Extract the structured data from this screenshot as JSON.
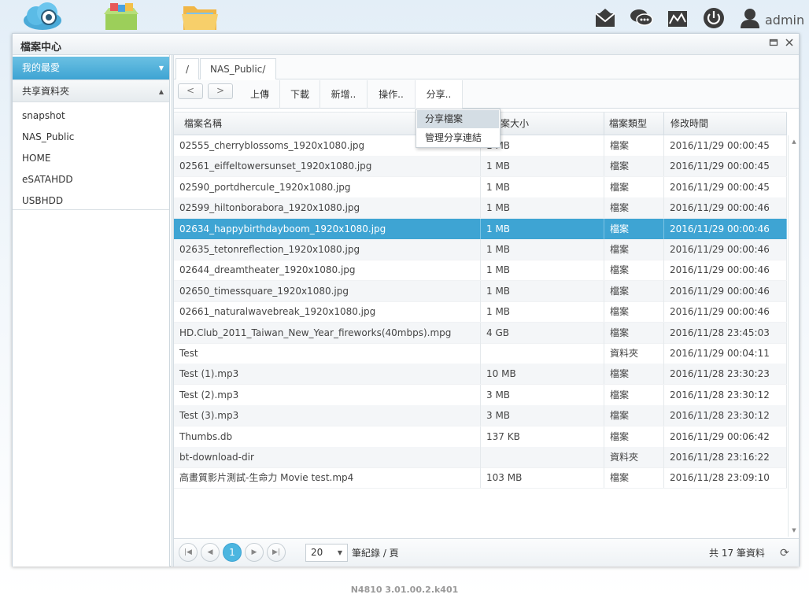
{
  "user": {
    "name": "admin"
  },
  "window": {
    "title": "檔案中心"
  },
  "sidebar": {
    "favorites_label": "我的最愛",
    "shared_label": "共享資料夾",
    "folders": [
      "snapshot",
      "NAS_Public",
      "HOME",
      "eSATAHDD",
      "USBHDD"
    ]
  },
  "breadcrumb": {
    "root": "/",
    "current": "NAS_Public/"
  },
  "toolbar": {
    "back": "<",
    "forward": ">",
    "upload": "上傳",
    "download": "下載",
    "new": "新增..",
    "action": "操作..",
    "share": "分享.."
  },
  "share_menu": {
    "items": [
      "分享檔案",
      "管理分享連結"
    ]
  },
  "grid": {
    "columns": [
      "檔案名稱",
      "檔案大小",
      "檔案類型",
      "修改時間"
    ],
    "rows": [
      {
        "name": "02555_cherryblossoms_1920x1080.jpg",
        "size": "1 MB",
        "type": "檔案",
        "modified": "2016/11/29 00:00:45"
      },
      {
        "name": "02561_eiffeltowersunset_1920x1080.jpg",
        "size": "1 MB",
        "type": "檔案",
        "modified": "2016/11/29 00:00:45"
      },
      {
        "name": "02590_portdhercule_1920x1080.jpg",
        "size": "1 MB",
        "type": "檔案",
        "modified": "2016/11/29 00:00:45"
      },
      {
        "name": "02599_hiltonborabora_1920x1080.jpg",
        "size": "1 MB",
        "type": "檔案",
        "modified": "2016/11/29 00:00:46"
      },
      {
        "name": "02634_happybirthdayboom_1920x1080.jpg",
        "size": "1 MB",
        "type": "檔案",
        "modified": "2016/11/29 00:00:46"
      },
      {
        "name": "02635_tetonreflection_1920x1080.jpg",
        "size": "1 MB",
        "type": "檔案",
        "modified": "2016/11/29 00:00:46"
      },
      {
        "name": "02644_dreamtheater_1920x1080.jpg",
        "size": "1 MB",
        "type": "檔案",
        "modified": "2016/11/29 00:00:46"
      },
      {
        "name": "02650_timessquare_1920x1080.jpg",
        "size": "1 MB",
        "type": "檔案",
        "modified": "2016/11/29 00:00:46"
      },
      {
        "name": "02661_naturalwavebreak_1920x1080.jpg",
        "size": "1 MB",
        "type": "檔案",
        "modified": "2016/11/29 00:00:46"
      },
      {
        "name": "HD.Club_2011_Taiwan_New_Year_fireworks(40mbps).mpg",
        "size": "4 GB",
        "type": "檔案",
        "modified": "2016/11/28 23:45:03"
      },
      {
        "name": "Test",
        "size": "",
        "type": "資料夾",
        "modified": "2016/11/29 00:04:11"
      },
      {
        "name": "Test (1).mp3",
        "size": "10 MB",
        "type": "檔案",
        "modified": "2016/11/28 23:30:23"
      },
      {
        "name": "Test (2).mp3",
        "size": "3 MB",
        "type": "檔案",
        "modified": "2016/11/28 23:30:12"
      },
      {
        "name": "Test (3).mp3",
        "size": "3 MB",
        "type": "檔案",
        "modified": "2016/11/28 23:30:12"
      },
      {
        "name": "Thumbs.db",
        "size": "137 KB",
        "type": "檔案",
        "modified": "2016/11/29 00:06:42"
      },
      {
        "name": "bt-download-dir",
        "size": "",
        "type": "資料夾",
        "modified": "2016/11/28 23:16:22"
      },
      {
        "name": "高畫質影片測試-生命力 Movie test.mp4",
        "size": "103 MB",
        "type": "檔案",
        "modified": "2016/11/28 23:09:10"
      }
    ],
    "selected_index": 4
  },
  "pager": {
    "current_page": "1",
    "page_size": "20",
    "per_page_label": "筆紀錄 / 頁",
    "total_label": "共 17 筆資料"
  },
  "footer": {
    "version": "N4810   3.01.00.2.k401"
  },
  "colors": {
    "accent": "#3ea4d3",
    "selected_row": "#3ea4d3"
  },
  "icons": [
    "cloud-icon",
    "app-store-icon",
    "folder-icon",
    "mail-icon",
    "chat-icon",
    "monitor-icon",
    "power-icon",
    "user-icon"
  ]
}
